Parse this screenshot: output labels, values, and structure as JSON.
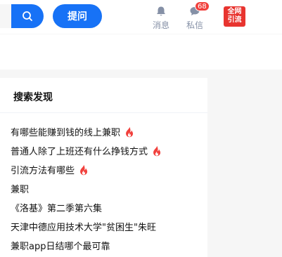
{
  "header": {
    "ask_label": "提问",
    "nav": {
      "messages_label": "消息",
      "private_label": "私信",
      "private_badge": "68"
    },
    "promo_lines": [
      "全网",
      "引流"
    ]
  },
  "discover": {
    "title": "搜索发现",
    "items": [
      {
        "text": "有哪些能赚到钱的线上兼职",
        "hot": true
      },
      {
        "text": "普通人除了上班还有什么挣钱方式",
        "hot": true
      },
      {
        "text": "引流方法有哪些",
        "hot": true
      },
      {
        "text": "兼职",
        "hot": false
      },
      {
        "text": "《洛基》第二季第六集",
        "hot": false
      },
      {
        "text": "天津中德应用技术大学\"贫困生\"朱旺",
        "hot": false
      },
      {
        "text": "兼职app日结哪个最可靠",
        "hot": false
      }
    ]
  },
  "colors": {
    "brand": "#1772f6",
    "hot_icon": "#f1403c",
    "promo": "#e8342f"
  }
}
